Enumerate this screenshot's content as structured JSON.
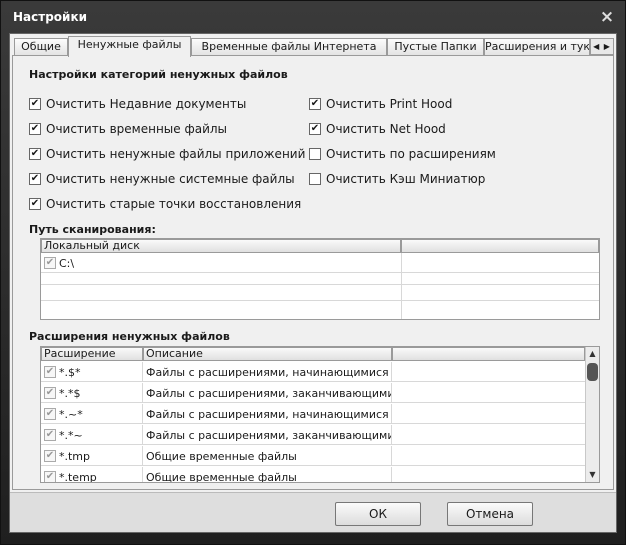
{
  "window": {
    "title": "Настройки",
    "close_glyph": "×"
  },
  "tabs": [
    {
      "label": "Общие",
      "active": false
    },
    {
      "label": "Ненужные файлы",
      "active": true
    },
    {
      "label": "Временные файлы Интернета",
      "active": false
    },
    {
      "label": "Пустые Папки",
      "active": false
    },
    {
      "label": "Расширения и тук",
      "active": false
    }
  ],
  "tab_scroll": "◀ ▶",
  "junk": {
    "section_title": "Настройки категорий ненужных файлов",
    "left": [
      {
        "label": "Очистить Недавние документы",
        "checked": true
      },
      {
        "label": "Очистить временные файлы",
        "checked": true
      },
      {
        "label": "Очистить ненужные файлы приложений",
        "checked": true
      },
      {
        "label": "Очистить ненужные системные файлы",
        "checked": true
      },
      {
        "label": "Очистить старые точки восстановления",
        "checked": true
      }
    ],
    "right": [
      {
        "label": "Очистить Print Hood",
        "checked": true
      },
      {
        "label": "Очистить Net Hood",
        "checked": true
      },
      {
        "label": "Очистить по расширениям",
        "checked": false
      },
      {
        "label": "Очистить Кэш Миниатюр",
        "checked": false
      }
    ]
  },
  "scan_path": {
    "section_title": "Путь сканирования:",
    "columns": [
      "Локальный диск",
      ""
    ],
    "rows": [
      {
        "path": "C:\\",
        "checked": true
      }
    ]
  },
  "extensions": {
    "section_title": "Расширения ненужных файлов",
    "columns": [
      "Расширение",
      "Описание",
      ""
    ],
    "rows": [
      {
        "ext": "*.$*",
        "desc": "Файлы с расширениями, начинающимися с $",
        "checked": true
      },
      {
        "ext": "*.*$",
        "desc": "Файлы с расширениями, заканчивающимися н...",
        "checked": true
      },
      {
        "ext": "*.~*",
        "desc": "Файлы с расширениями, начинающимися с ~",
        "checked": true
      },
      {
        "ext": "*.*~",
        "desc": "Файлы с расширениями, заканчивающимися н...",
        "checked": true
      },
      {
        "ext": "*.tmp",
        "desc": "Общие временные файлы",
        "checked": true
      },
      {
        "ext": "*.temp",
        "desc": "Общие временные файлы",
        "checked": true
      }
    ]
  },
  "buttons": {
    "ok": "ОК",
    "cancel": "Отмена"
  },
  "check_glyph": "✔",
  "colors": {
    "title_bg": "#2b2b2b",
    "client_bg": "#f0f0f0",
    "footer_bg": "#dedede"
  }
}
